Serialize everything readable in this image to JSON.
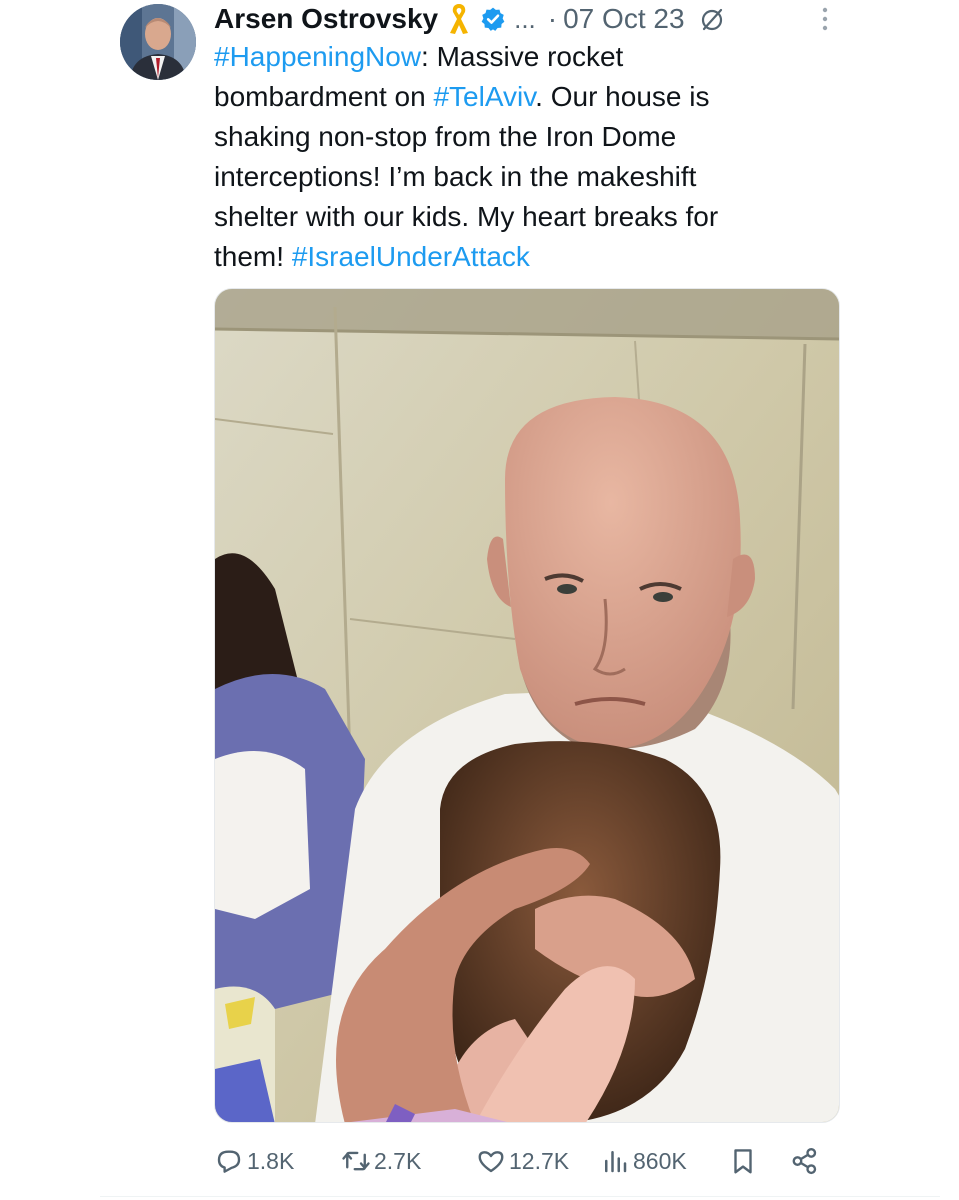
{
  "author": {
    "name": "Arsen Ostrovsky",
    "truncation": "...",
    "separator": "·",
    "date": "07 Oct 23"
  },
  "post": {
    "lines": [
      [
        {
          "text": "#HappeningNow",
          "tag": true
        },
        {
          "text": ": Massive rocket",
          "tag": false
        }
      ],
      [
        {
          "text": "bombardment on ",
          "tag": false
        },
        {
          "text": "#TelAviv",
          "tag": true
        },
        {
          "text": ". Our house is",
          "tag": false
        }
      ],
      [
        {
          "text": "shaking non-stop from the Iron Dome",
          "tag": false
        }
      ],
      [
        {
          "text": "interceptions! I’m back in the makeshift",
          "tag": false
        }
      ],
      [
        {
          "text": "shelter with our kids. My heart breaks for",
          "tag": false
        }
      ],
      [
        {
          "text": "them! ",
          "tag": false
        },
        {
          "text": "#IsraelUnderAttack",
          "tag": true
        }
      ]
    ]
  },
  "actions": {
    "replies": "1.8K",
    "reposts": "2.7K",
    "likes": "12.7K",
    "views": "860K"
  },
  "icons": [
    "yellow-ribbon-icon",
    "verified-badge-icon",
    "edited-icon",
    "more-options-icon",
    "reply-icon",
    "repost-icon",
    "like-icon",
    "views-icon",
    "bookmark-icon",
    "share-icon"
  ],
  "colors": {
    "accent": "#1d9bf0",
    "text": "#0f1419",
    "secondary": "#536471",
    "ribbon": "#f5b400"
  }
}
